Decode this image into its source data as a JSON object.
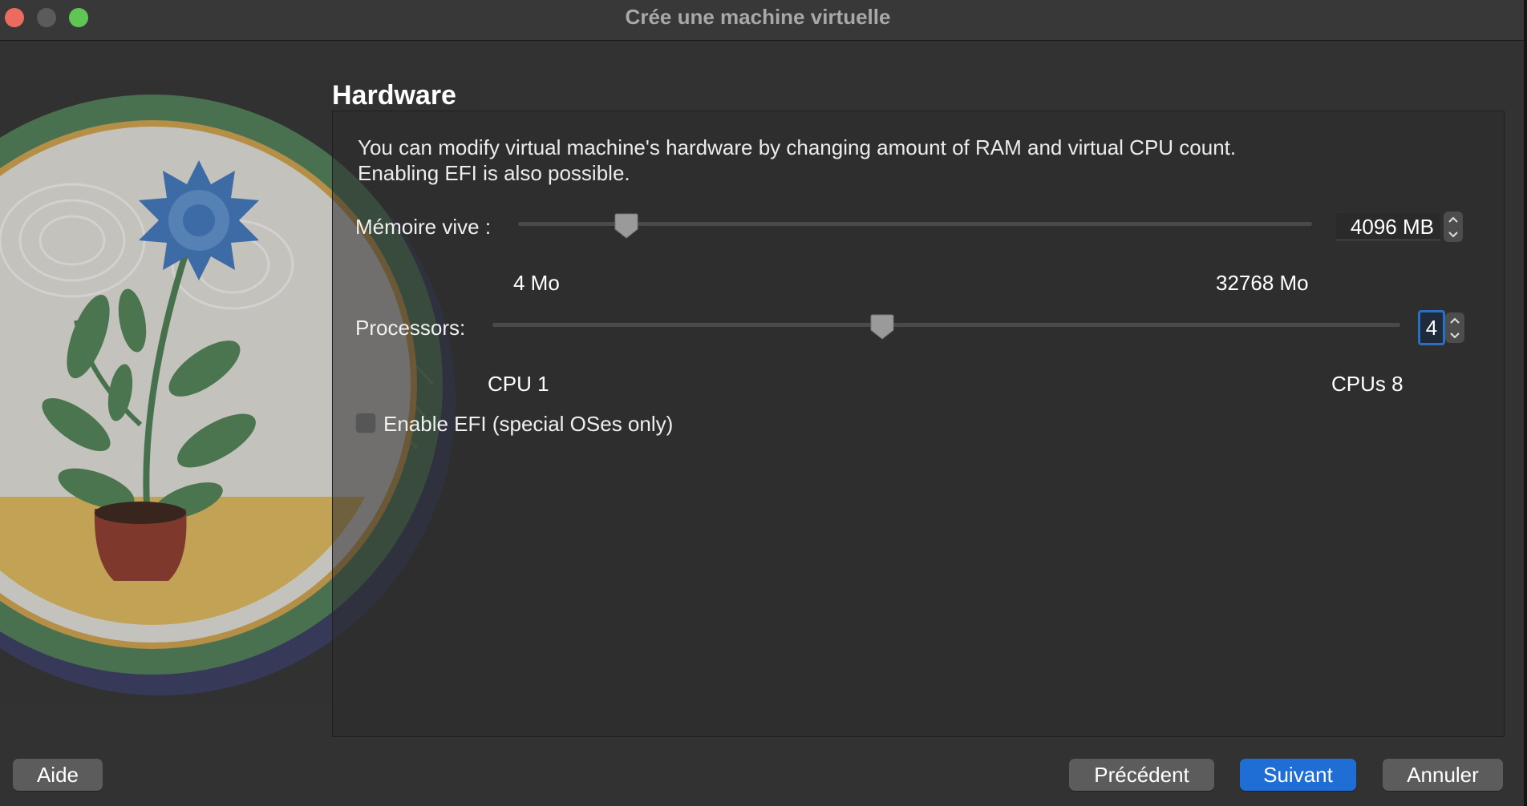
{
  "window": {
    "title": "Crée une machine virtuelle"
  },
  "page": {
    "heading": "Hardware",
    "description_line1": "You can modify virtual machine's hardware by changing amount of RAM and virtual CPU count.",
    "description_line2": "Enabling EFI is also possible."
  },
  "memory": {
    "label": "Mémoire vive :",
    "value": "4096 MB",
    "min_label": "4 Mo",
    "max_label": "32768 Mo"
  },
  "processors": {
    "label": "Processors:",
    "value": "4",
    "min_label": "CPU 1",
    "max_label": "CPUs 8"
  },
  "efi": {
    "label": "Enable EFI (special OSes only)",
    "checked": false
  },
  "buttons": {
    "help": "Aide",
    "previous": "Précédent",
    "next": "Suivant",
    "cancel": "Annuler"
  },
  "colors": {
    "accent": "#1f6ed6",
    "focus_ring": "#2c6fbf",
    "close": "#ed6a5e",
    "maximize": "#61c554"
  },
  "icons": {
    "stepper_up": "chevron-up-icon",
    "stepper_down": "chevron-down-icon"
  }
}
